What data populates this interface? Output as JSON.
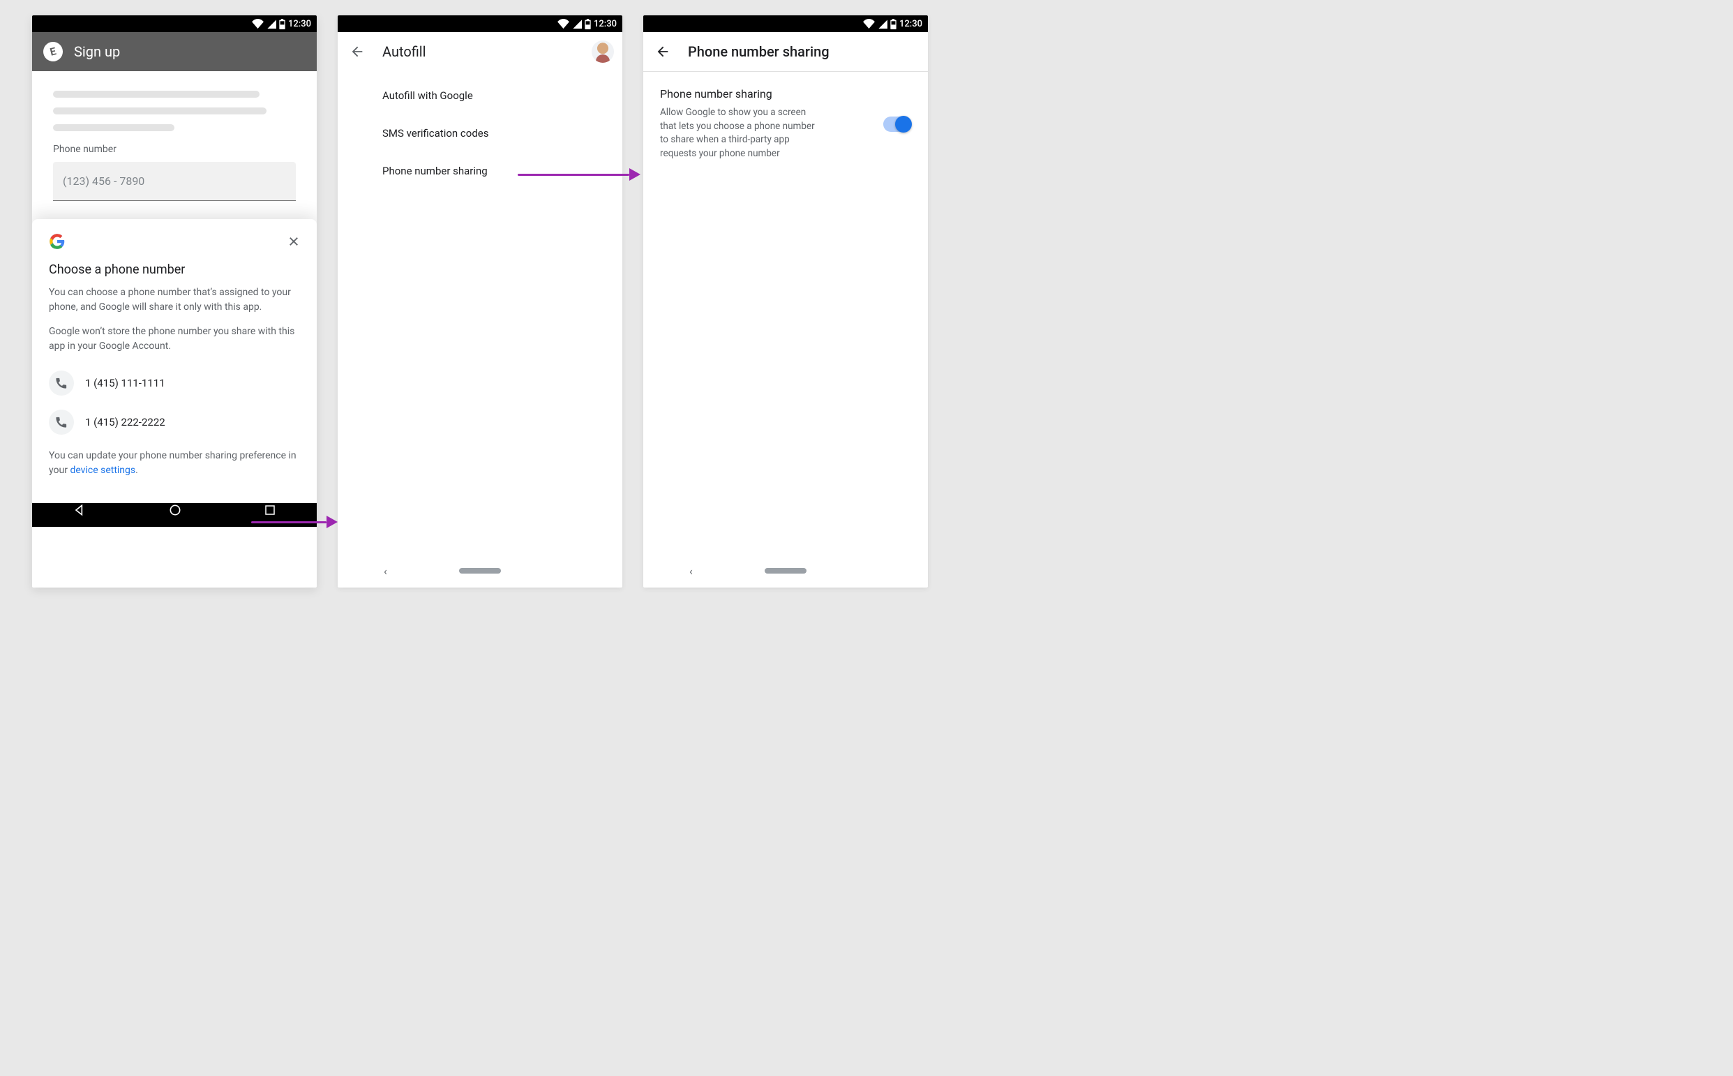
{
  "status": {
    "time": "12:30"
  },
  "screen1": {
    "app_title": "Sign up",
    "field_label": "Phone number",
    "field_placeholder": "(123) 456 - 7890",
    "sheet": {
      "title": "Choose a phone number",
      "body1": "You can choose a phone number that’s assigned to your phone, and Google will share it only with this app.",
      "body2": "Google won’t store the phone number you share with this app in your Google Account.",
      "options": [
        {
          "number": "1 (415) 111-1111"
        },
        {
          "number": "1 (415) 222-2222"
        }
      ],
      "footer_pre": "You can update your phone number sharing preference in your ",
      "footer_link": "device settings",
      "footer_post": "."
    }
  },
  "screen2": {
    "title": "Autofill",
    "items": [
      {
        "label": "Autofill with Google"
      },
      {
        "label": "SMS verification codes"
      },
      {
        "label": "Phone number sharing"
      }
    ]
  },
  "screen3": {
    "title": "Phone number sharing",
    "pref_title": "Phone number sharing",
    "pref_desc": "Allow Google to show you a screen that lets you choose a phone number to share when a third-party app requests your phone number",
    "switch_on": true
  }
}
